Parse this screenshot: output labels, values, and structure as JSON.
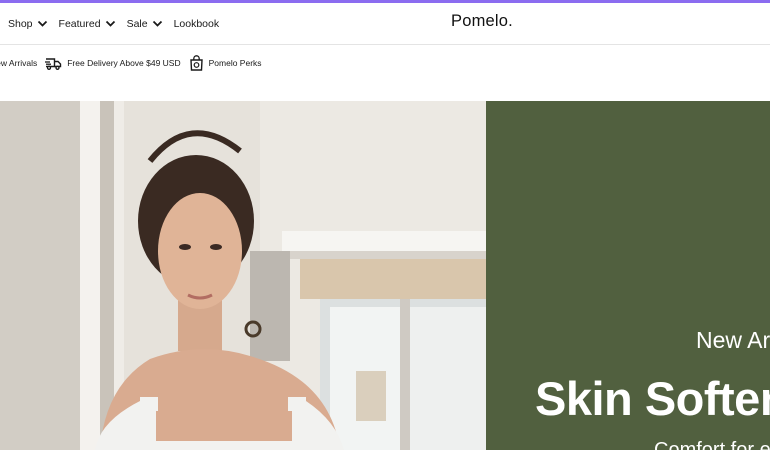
{
  "nav": {
    "items": [
      {
        "label": "Shop",
        "has_dropdown": true
      },
      {
        "label": "Featured",
        "has_dropdown": true
      },
      {
        "label": "Sale",
        "has_dropdown": true
      },
      {
        "label": "Lookbook",
        "has_dropdown": false
      }
    ],
    "logo": "Pomelo."
  },
  "perks": {
    "new_arrivals": "New Arrivals",
    "delivery": "Free Delivery Above $49 USD",
    "perks": "Pomelo Perks"
  },
  "hero": {
    "kicker": "New Arrivals",
    "headline": "Skin Softeners",
    "subline": "Comfort for every day",
    "panel_color": "#51603f"
  },
  "colors": {
    "accent": "#8b6cf0",
    "text": "#1a1a1a"
  },
  "icons": [
    "chevron-down-icon",
    "delivery-truck-icon",
    "shopping-bag-icon"
  ]
}
